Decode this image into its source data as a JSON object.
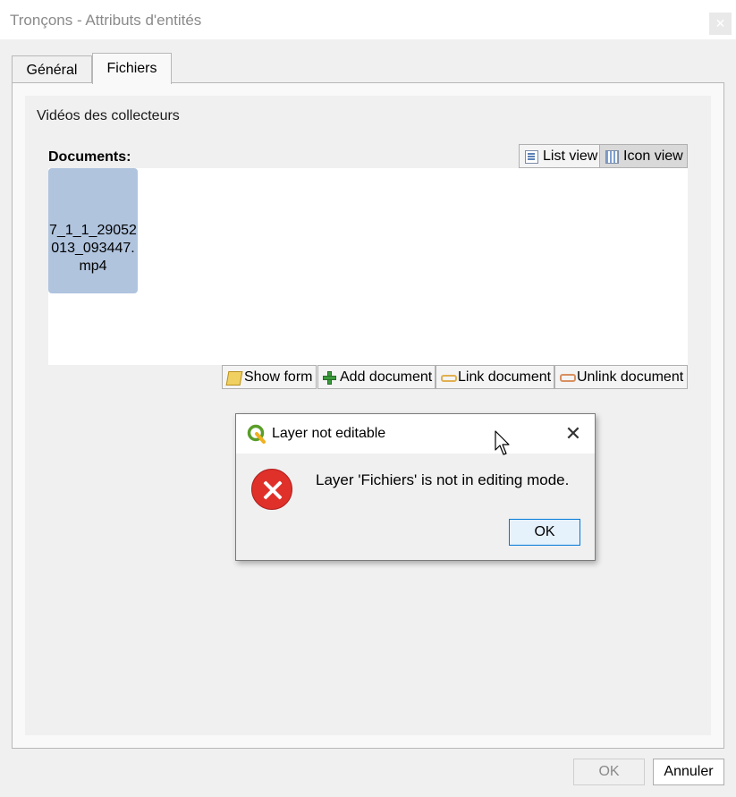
{
  "window": {
    "title": "Tronçons - Attributs d'entités",
    "close_symbol": "✕"
  },
  "tabs": [
    {
      "label": "Général",
      "active": false
    },
    {
      "label": "Fichiers",
      "active": true
    }
  ],
  "group": {
    "title": "Vidéos des collecteurs",
    "documents_label": "Documents:",
    "view_buttons": {
      "list": "List view",
      "icon": "Icon view",
      "selected": "icon"
    },
    "documents": [
      {
        "name": "7_1_1_29052013_093447.mp4"
      }
    ],
    "actions": {
      "show_form": "Show form",
      "add_document": "Add document",
      "link_document": "Link document",
      "unlink_document": "Unlink document"
    }
  },
  "message_box": {
    "title": "Layer not editable",
    "text": "Layer 'Fichiers' is not in editing mode.",
    "ok": "OK",
    "close_symbol": "✕",
    "icon": "error-icon"
  },
  "dialog_buttons": {
    "ok": "OK",
    "cancel": "Annuler"
  },
  "colors": {
    "document_tile": "#b0c4de",
    "error_red": "#e0302a",
    "focus_blue": "#0078d7"
  }
}
